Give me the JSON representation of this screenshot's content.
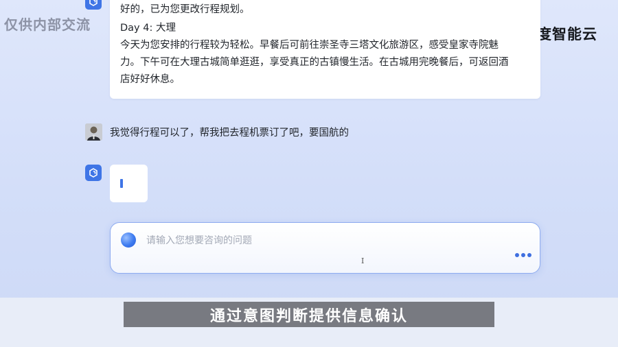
{
  "watermark": "仅供内部交流",
  "brand": {
    "name": "百度智能云",
    "colors": {
      "green": "#8cc63f",
      "blue": "#2f6fd8",
      "teal": "#2bb3a9"
    }
  },
  "chat": {
    "previous_reply": {
      "lines": [
        "好的，已为您更改行程规划。",
        "Day 4: 大理",
        "今天为您安排的行程较为轻松。早餐后可前往崇圣寺三塔文化旅游区，感受皇家寺院魅",
        "力。下午可在大理古城简单逛逛，享受真正的古镇慢生活。在古城用完晚餐后，可返回酒",
        "店好好休息。"
      ]
    },
    "user_message": "我觉得行程可以了，帮我把去程机票订了吧，要国航的",
    "bot_typing": true
  },
  "input": {
    "value": "",
    "placeholder": "请输入您想要咨询的问题",
    "more_icon": "more-dots-icon"
  },
  "caption": "通过意图判断提供信息确认",
  "colors": {
    "accent": "#3f75e6",
    "background": "#d3def9",
    "caption_bg": "#6e7076"
  }
}
